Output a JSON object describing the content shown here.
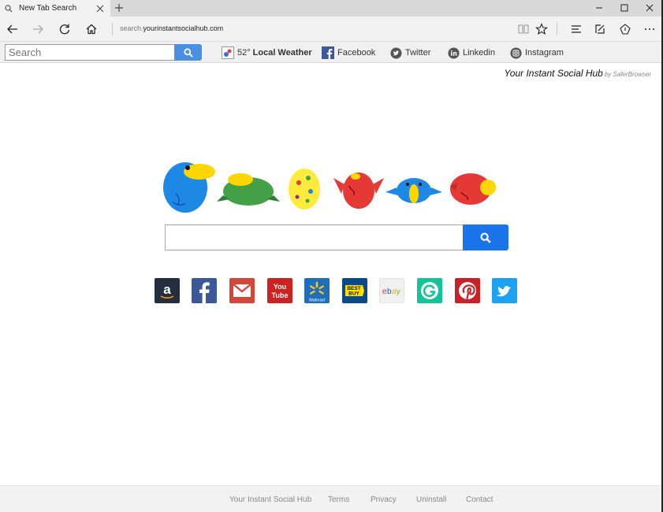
{
  "tab": {
    "title": "New Tab Search"
  },
  "address": {
    "prefix": "search.",
    "domain": "yourinstantsocialhub.com"
  },
  "toolbar": {
    "search_placeholder": "Search",
    "weather_temp": "52°",
    "weather_label": "Local Weather",
    "links": [
      "Facebook",
      "Twitter",
      "Linkedin",
      "Instagram"
    ]
  },
  "brand": {
    "name": "Your Instant Social Hub",
    "by": "by SaferBrowser"
  },
  "quick_links": [
    {
      "name": "amazon",
      "text": "a",
      "color": "#232f3e"
    },
    {
      "name": "facebook",
      "text": "f",
      "color": "#3b5998"
    },
    {
      "name": "gmail",
      "text": "",
      "color": "#d44638"
    },
    {
      "name": "youtube",
      "text": "You Tube",
      "color": "#cc2222"
    },
    {
      "name": "walmart",
      "text": "Walmart",
      "color": "#1c6fb8"
    },
    {
      "name": "bestbuy",
      "text": "BEST BUY",
      "color": "#0a4a8a"
    },
    {
      "name": "ebay",
      "text": "ebay",
      "color": "#f0f0f0"
    },
    {
      "name": "grammarly",
      "text": "G",
      "color": "#15c39a"
    },
    {
      "name": "pinterest",
      "text": "P",
      "color": "#cb2027"
    },
    {
      "name": "twitter",
      "text": "",
      "color": "#1da1f2"
    }
  ],
  "footer": {
    "links": [
      "Your Instant Social Hub",
      "Terms",
      "Privacy",
      "Uninstall",
      "Contact"
    ]
  }
}
